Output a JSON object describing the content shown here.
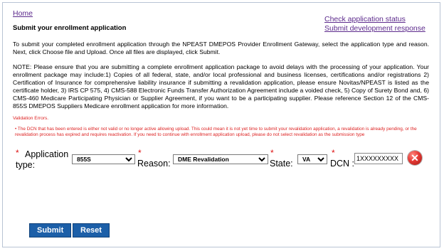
{
  "links": {
    "home": "Home",
    "check_status": "Check application status",
    "submit_dev": "Submit development response"
  },
  "page_title": "Submit your enrollment application",
  "intro": "To submit your completed enrollment application through the NPEAST DMEPOS Provider Enrollment Gateway, select the application type and reason. Next, click Choose file and Upload. Once all files are displayed, click Submit.",
  "note": "NOTE: Please ensure that you are submitting a complete enrollment application package to avoid delays with the processing of your application. Your enrollment package may include:1) Copies of all federal, state, and/or local professional and business licenses, certifications and/or registrations 2) Certification of Insurance for comprehensive liability insurance if submitting a revalidation application, please ensure Novitas/NPEAST is listed as the certificate holder, 3) IRS CP 575, 4) CMS-588 Electronic Funds Transfer Authorization Agreement include a voided check, 5) Copy of Surety Bond and, 6) CMS-460 Medicare Participating Physician or Supplier Agreement, if you want to be a participating supplier. Please reference Section 12 of the CMS-855S DMEPOS Suppliers Medicare enrollment application for more information.",
  "validation": {
    "title": "Validation Errors.",
    "bullet": "•",
    "message": "The DCN that has been entered is either not valid or no longer active allowing upload. This could mean it is not yet time to submit your revalidation application, a revalidation is already pending, or the revalidation process has expired and requires reactivation. If you need to continue with enrollment application upload, please do not select revalidation as the submission type"
  },
  "form": {
    "required_mark": "*",
    "app_type_label_1": "Application",
    "app_type_label_2": "type:",
    "app_type_value": "855S",
    "reason_label": "Reason:",
    "reason_value": "DME Revalidation",
    "state_label": "State:",
    "state_value": "VA",
    "dcn_label": "DCN :",
    "dcn_value": "1XXXXXXXXX",
    "remove_glyph": "✕"
  },
  "buttons": {
    "submit": "Submit",
    "reset": "Reset"
  },
  "colors": {
    "link": "#5c2a8c",
    "error": "#dd2222",
    "button": "#1c5fa8"
  }
}
